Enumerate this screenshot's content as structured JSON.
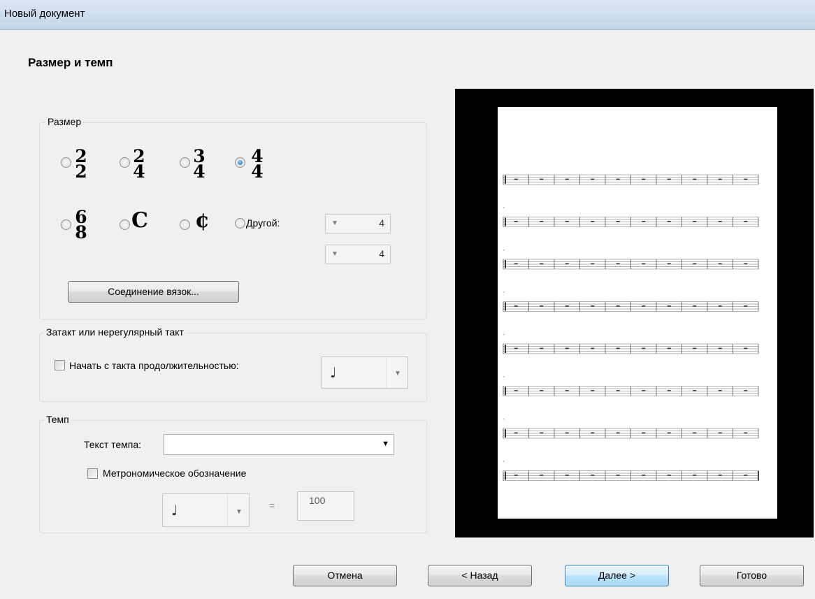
{
  "window": {
    "title": "Новый документ"
  },
  "page_heading": "Размер и темп",
  "size_group": {
    "legend": "Размер",
    "options": [
      {
        "top": "2",
        "bottom": "2",
        "checked": false
      },
      {
        "top": "2",
        "bottom": "4",
        "checked": false
      },
      {
        "top": "3",
        "bottom": "4",
        "checked": false
      },
      {
        "top": "4",
        "bottom": "4",
        "checked": true
      },
      {
        "top": "6",
        "bottom": "8",
        "checked": false
      }
    ],
    "common_time": "C",
    "cut_time": "¢",
    "other_label": "Другой:",
    "other_numerator": "4",
    "other_denominator": "4",
    "beam_button": "Соединение вязок..."
  },
  "pickup_group": {
    "legend": "Затакт или нерегулярный такт",
    "checkbox_label": "Начать с такта продолжительностью:",
    "note_symbol": "♩"
  },
  "tempo_group": {
    "legend": "Темп",
    "tempo_text_label": "Текст темпа:",
    "tempo_text_value": "",
    "metronome_label": "Метрономическое обозначение",
    "note_symbol": "♩",
    "equals": "=",
    "bpm": "100"
  },
  "preview": {
    "systems": 8,
    "measures_per_system": 10
  },
  "buttons": {
    "cancel": "Отмена",
    "back": "< Назад",
    "next": "Далее >",
    "finish": "Готово"
  }
}
